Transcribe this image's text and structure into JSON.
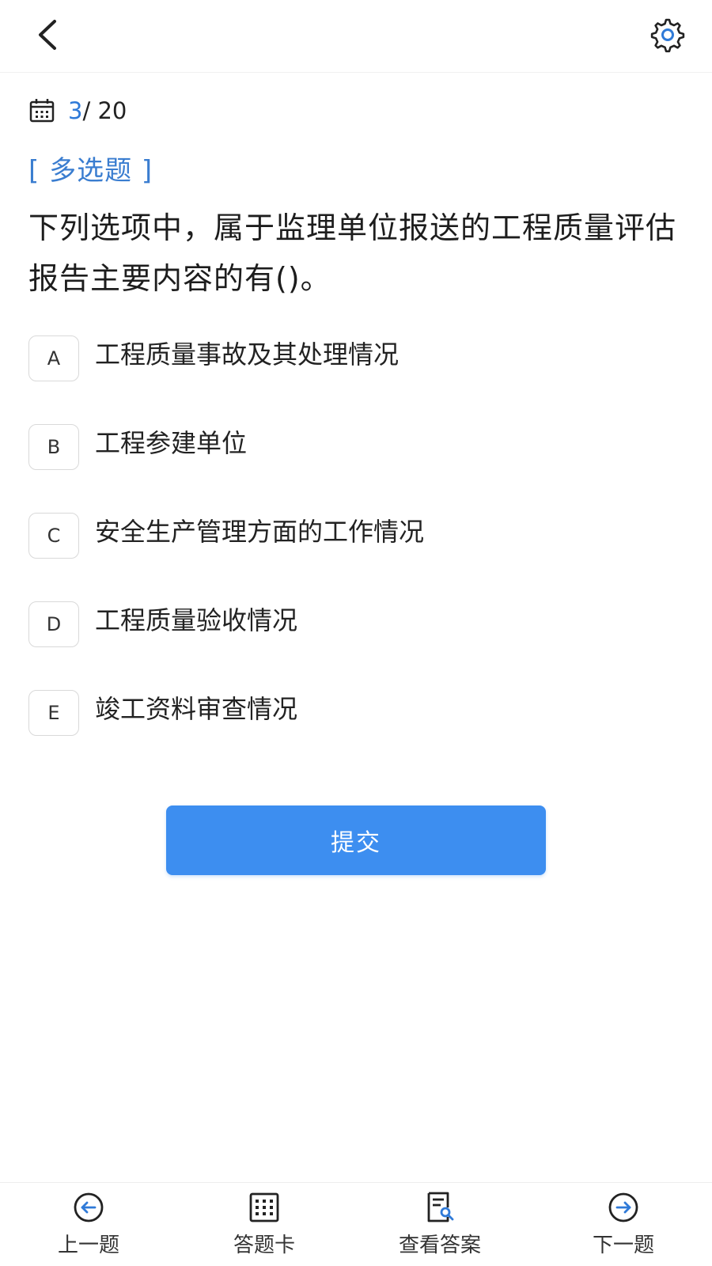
{
  "header": {
    "back_icon": "chevron-left-icon",
    "settings_icon": "gear-icon"
  },
  "progress": {
    "icon": "calendar-icon",
    "current": "3",
    "total": "/ 20"
  },
  "question": {
    "type_label": "[ 多选题 ]",
    "text": "下列选项中，属于监理单位报送的工程质量评估报告主要内容的有()。",
    "options": [
      {
        "letter": "A",
        "text": "工程质量事故及其处理情况"
      },
      {
        "letter": "B",
        "text": "工程参建单位"
      },
      {
        "letter": "C",
        "text": "安全生产管理方面的工作情况"
      },
      {
        "letter": "D",
        "text": "工程质量验收情况"
      },
      {
        "letter": "E",
        "text": "竣工资料审查情况"
      }
    ]
  },
  "submit_label": "提交",
  "bottom_nav": {
    "prev": {
      "label": "上一题",
      "icon": "arrow-left-circle-icon"
    },
    "card": {
      "label": "答题卡",
      "icon": "grid-card-icon"
    },
    "answer": {
      "label": "查看答案",
      "icon": "document-search-icon"
    },
    "next": {
      "label": "下一题",
      "icon": "arrow-right-circle-icon"
    }
  },
  "colors": {
    "accent": "#3d8ef0",
    "type_label": "#3a7dd0",
    "progress_current": "#2f7ad8"
  }
}
